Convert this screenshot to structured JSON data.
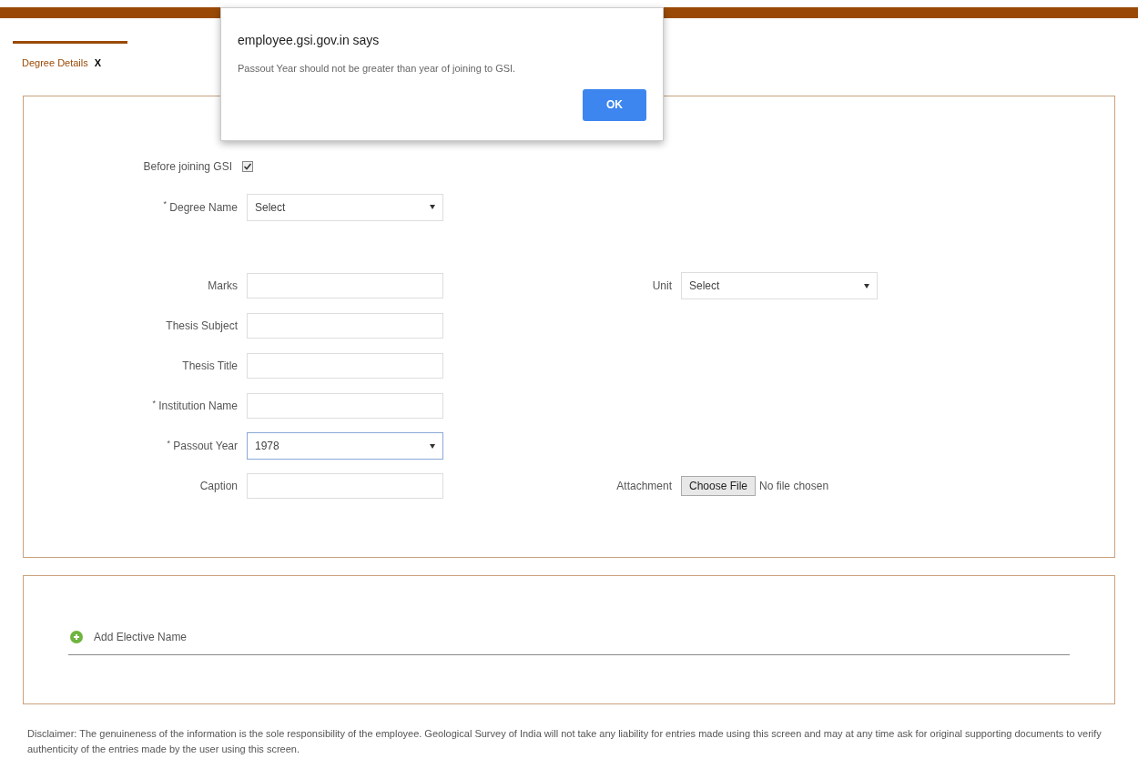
{
  "tab": {
    "label": "Degree Details",
    "close": "X",
    "selected": true
  },
  "form": {
    "top_rows": [
      {
        "left": {
          "kind": "checkbox",
          "label": "Before joining GSI",
          "checked": true
        }
      },
      {
        "left": {
          "kind": "select",
          "label": "$^{*}$ Degree Name",
          "value": "Select"
        }
      }
    ],
    "rows": [
      {
        "left": {
          "kind": "text",
          "label": "Marks"
        },
        "right": {
          "kind": "select",
          "label": "Unit",
          "value": "Select"
        }
      },
      {
        "left": {
          "kind": "text",
          "label": "Thesis Subject"
        }
      },
      {
        "left": {
          "kind": "text",
          "label": "Thesis Title"
        }
      },
      {
        "left": {
          "kind": "text",
          "label": "$^{*}$ Institution Name"
        }
      },
      {
        "left": {
          "kind": "select",
          "label": "$^{*}$ Passout Year",
          "value": "1978",
          "focused": true
        }
      },
      {
        "left": {
          "kind": "text",
          "label": "Caption"
        },
        "right": {
          "kind": "file",
          "label": "Attachment",
          "button": "Choose File",
          "status": "No file chosen"
        }
      }
    ]
  },
  "electives": {
    "add_label": "Add Elective Name"
  },
  "disclaimer": "Disclaimer: The genuineness of the information is the sole responsibility of the employee. Geological Survey of India will not take any liability for entries made using this screen and may at any time ask for original supporting documents to verify authenticity of the entries made by the user using this screen.",
  "dialog": {
    "title": "employee.gsi.gov.in says",
    "message": "Passout Year should not be greater than year of joining to GSI.",
    "button": "OK"
  }
}
